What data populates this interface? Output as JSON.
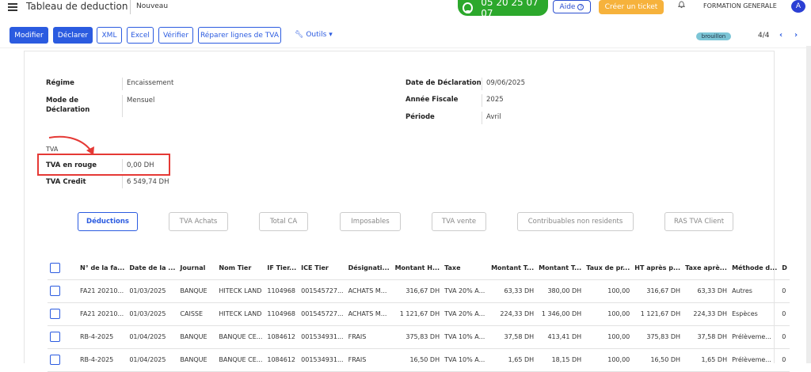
{
  "header": {
    "app_title": "Tableau de deduction",
    "breadcrumb": "Nouveau",
    "phone": "05 20 25 07 07",
    "help_label": "Aide",
    "ticket_label": "Créer un ticket",
    "company": "FORMATION GENERALE",
    "avatar_initial": "A"
  },
  "toolbar": {
    "modifier": "Modifier",
    "declarer": "Déclarer",
    "xml": "XML",
    "excel": "Excel",
    "verifier": "Vérifier",
    "reparer": "Réparer lignes de TVA",
    "outils": "Outils",
    "status_badge": "brouillon",
    "pager": "4/4"
  },
  "form": {
    "regime_label": "Régime",
    "regime_value": "Encaissement",
    "mode_label_1": "Mode de",
    "mode_label_2": "Déclaration",
    "mode_value": "Mensuel",
    "date_label": "Date de Déclaration",
    "date_value": "09/06/2025",
    "annee_label": "Année Fiscale",
    "annee_value": "2025",
    "periode_label": "Période",
    "periode_value": "Avril",
    "tva_section": "TVA",
    "tva_rouge_label": "TVA en rouge",
    "tva_rouge_value": "0,00 DH",
    "tva_credit_label": "TVA Credit",
    "tva_credit_value": "6 549,74 DH"
  },
  "tabs": [
    {
      "label": "Déductions",
      "active": true
    },
    {
      "label": "TVA Achats"
    },
    {
      "label": "Total CA"
    },
    {
      "label": "Imposables"
    },
    {
      "label": "TVA vente"
    },
    {
      "label": "Contribuables non residents"
    },
    {
      "label": "RAS TVA Client"
    }
  ],
  "table": {
    "columns": [
      "N° de la fa...",
      "Date de la ...",
      "Journal",
      "Nom Tier",
      "IF Tier...",
      "ICE Tier",
      "Désignati...",
      "Montant H...",
      "Taxe",
      "Montant T...",
      "Montant T...",
      "Taux de pr...",
      "HT après p...",
      "Taxe aprè...",
      "Méthode d...",
      "D"
    ],
    "rows": [
      [
        "FA21 20210...",
        "01/03/2025",
        "BANQUE",
        "HITECK LAND",
        "1104968",
        "001545727...",
        "ACHATS M...",
        "316,67 DH",
        "TVA 20% A...",
        "63,33 DH",
        "380,00 DH",
        "100,00",
        "316,67 DH",
        "63,33 DH",
        "Autres",
        "0"
      ],
      [
        "FA21 20210...",
        "01/03/2025",
        "CAISSE",
        "HITECK LAND",
        "1104968",
        "001545727...",
        "ACHATS M...",
        "1 121,67 DH",
        "TVA 20% A...",
        "224,33 DH",
        "1 346,00 DH",
        "100,00",
        "1 121,67 DH",
        "224,33 DH",
        "Espèces",
        "0"
      ],
      [
        "RB-4-2025",
        "01/04/2025",
        "BANQUE",
        "BANQUE CE...",
        "1084612",
        "001534931...",
        "FRAIS",
        "375,83 DH",
        "TVA 10% A...",
        "37,58 DH",
        "413,41 DH",
        "100,00",
        "375,83 DH",
        "37,58 DH",
        "Prélèveme...",
        "0"
      ],
      [
        "RB-4-2025",
        "01/04/2025",
        "BANQUE",
        "BANQUE CE...",
        "1084612",
        "001534931...",
        "FRAIS",
        "16,50 DH",
        "TVA 10% A...",
        "1,65 DH",
        "18,15 DH",
        "100,00",
        "16,50 DH",
        "1,65 DH",
        "Prélèveme...",
        "0"
      ]
    ]
  },
  "colors": {
    "primary": "#2b5be0",
    "phone_green": "#2ca82c",
    "ticket_orange": "#f6b23c",
    "highlight_red": "#e53935",
    "badge_teal": "#7cc5d6"
  }
}
